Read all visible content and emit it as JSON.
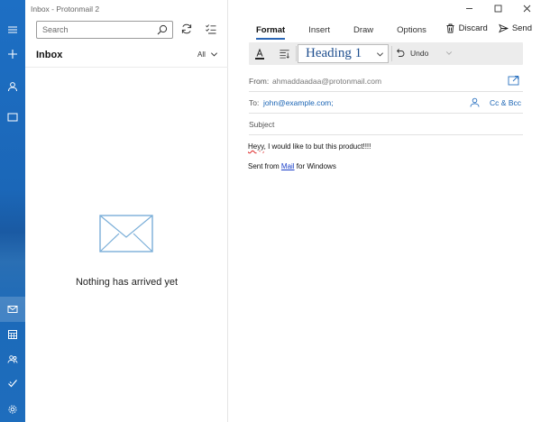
{
  "window": {
    "title": "Inbox - Protonmail 2"
  },
  "rail": {
    "items": [
      {
        "icon": "hamburger-icon"
      },
      {
        "icon": "plus-icon"
      },
      {
        "icon": "person-icon"
      },
      {
        "icon": "folder-icon"
      },
      {
        "icon": "mail-icon",
        "active": true
      },
      {
        "icon": "calendar-icon"
      },
      {
        "icon": "people-icon"
      },
      {
        "icon": "todo-icon"
      },
      {
        "icon": "settings-icon"
      }
    ]
  },
  "list": {
    "search_placeholder": "Search",
    "folder_title": "Inbox",
    "filter_label": "All",
    "empty_message": "Nothing has arrived yet"
  },
  "compose": {
    "tabs": [
      "Format",
      "Insert",
      "Draw",
      "Options"
    ],
    "active_tab": "Format",
    "discard_label": "Discard",
    "send_label": "Send",
    "style_value": "Heading 1",
    "undo_label": "Undo",
    "from_label": "From:",
    "from_value": "ahmaddaadaa@protonmail.com",
    "to_label": "To:",
    "to_value": "john@example.com;",
    "ccbcc_label": "Cc & Bcc",
    "subject_placeholder": "Subject",
    "body": {
      "misspelled_word": "Heyy",
      "line1_rest": ", I would like to but this product!!!!",
      "signature_prefix": "Sent from ",
      "signature_link": "Mail",
      "signature_suffix": " for Windows"
    }
  },
  "colors": {
    "accent": "#2b66b5",
    "rail": "#1d6fc4",
    "link": "#1a64b4"
  }
}
